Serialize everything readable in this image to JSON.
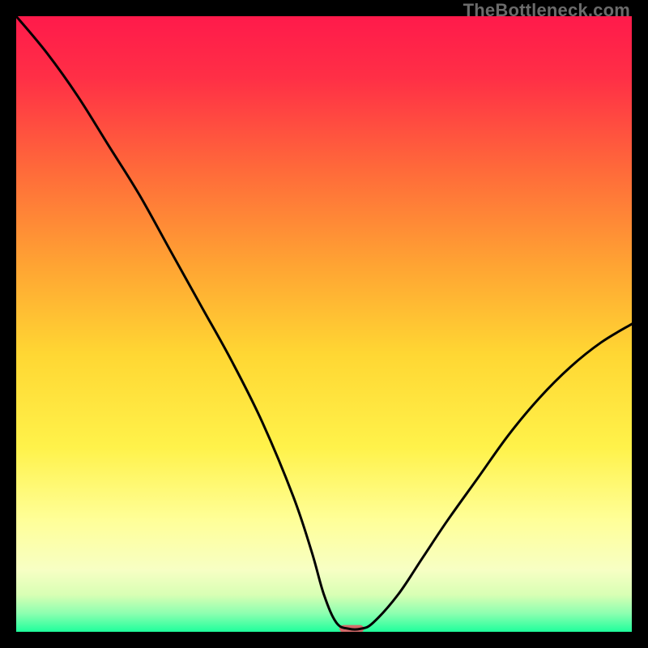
{
  "watermark": "TheBottleneck.com",
  "chart_data": {
    "type": "line",
    "title": "",
    "xlabel": "",
    "ylabel": "",
    "xlim": [
      0,
      100
    ],
    "ylim": [
      0,
      100
    ],
    "background_gradient": {
      "stops": [
        {
          "offset": 0.0,
          "color": "#ff1a4b"
        },
        {
          "offset": 0.1,
          "color": "#ff2f46"
        },
        {
          "offset": 0.25,
          "color": "#ff6a3a"
        },
        {
          "offset": 0.4,
          "color": "#ffa233"
        },
        {
          "offset": 0.55,
          "color": "#ffd733"
        },
        {
          "offset": 0.7,
          "color": "#fff24a"
        },
        {
          "offset": 0.82,
          "color": "#ffff99"
        },
        {
          "offset": 0.9,
          "color": "#f7ffc4"
        },
        {
          "offset": 0.94,
          "color": "#d8ffb4"
        },
        {
          "offset": 0.97,
          "color": "#8dffb0"
        },
        {
          "offset": 1.0,
          "color": "#1fff9c"
        }
      ]
    },
    "series": [
      {
        "name": "bottleneck-curve",
        "x": [
          0.0,
          5.0,
          10.0,
          15.0,
          20.0,
          25.0,
          30.0,
          35.0,
          40.0,
          45.0,
          48.0,
          50.0,
          52.0,
          54.0,
          56.0,
          58.0,
          62.0,
          66.0,
          70.0,
          75.0,
          80.0,
          85.0,
          90.0,
          95.0,
          100.0
        ],
        "y": [
          100.0,
          94.0,
          87.0,
          79.0,
          71.0,
          62.0,
          53.0,
          44.0,
          34.0,
          22.0,
          13.0,
          6.0,
          1.5,
          0.5,
          0.5,
          1.5,
          6.0,
          12.0,
          18.0,
          25.0,
          32.0,
          38.0,
          43.0,
          47.0,
          50.0
        ]
      }
    ],
    "marker": {
      "name": "optimal-range",
      "x": 54.5,
      "y": 0.5,
      "width": 4.0,
      "height": 1.2,
      "color": "#d46a6a"
    }
  }
}
